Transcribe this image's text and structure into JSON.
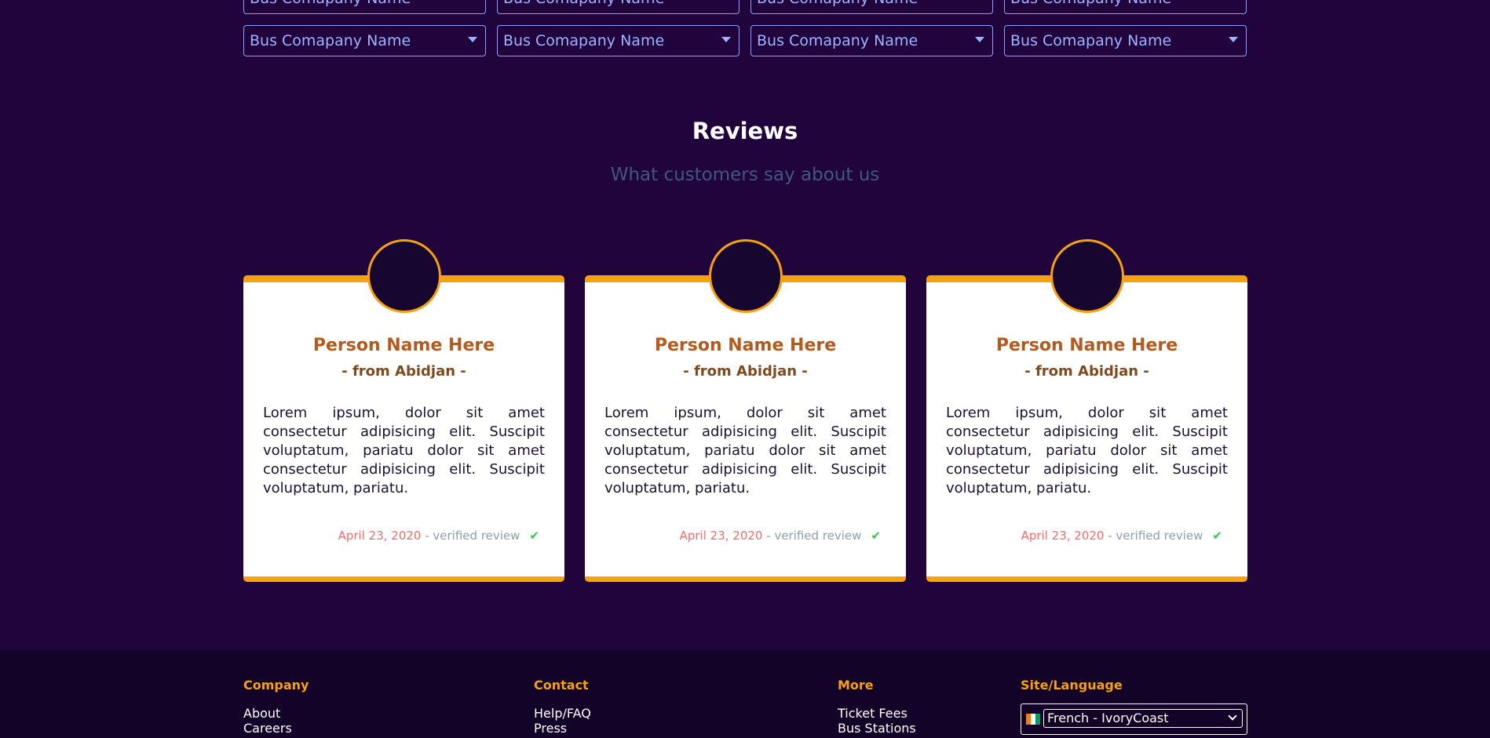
{
  "bus_companies": {
    "row1": [
      "Bus Comapany Name",
      "Bus Comapany Name",
      "Bus Comapany Name",
      "Bus Comapany Name"
    ],
    "row2": [
      "Bus Comapany Name",
      "Bus Comapany Name",
      "Bus Comapany Name",
      "Bus Comapany Name"
    ]
  },
  "reviews": {
    "title": "Reviews",
    "subtitle": "What customers say about us",
    "cards": [
      {
        "name": "Person Name Here",
        "from": "- from Abidjan -",
        "text": "Lorem ipsum, dolor sit amet consectetur adipisicing elit. Suscipit voluptatum, pariatu dolor sit amet consectetur adipisicing elit. Suscipit voluptatum, pariatu.",
        "date": "April 23, 2020",
        "verified": " - verified review"
      },
      {
        "name": "Person Name Here",
        "from": "- from Abidjan -",
        "text": "Lorem ipsum, dolor sit amet consectetur adipisicing elit. Suscipit voluptatum, pariatu dolor sit amet consectetur adipisicing elit. Suscipit voluptatum, pariatu.",
        "date": "April 23, 2020",
        "verified": " - verified review"
      },
      {
        "name": "Person Name Here",
        "from": "- from Abidjan -",
        "text": "Lorem ipsum, dolor sit amet consectetur adipisicing elit. Suscipit voluptatum, pariatu dolor sit amet consectetur adipisicing elit. Suscipit voluptatum, pariatu.",
        "date": "April 23, 2020",
        "verified": " - verified review"
      }
    ]
  },
  "footer": {
    "company": {
      "heading": "Company",
      "links": [
        "About",
        "Careers"
      ]
    },
    "contact": {
      "heading": "Contact",
      "links": [
        "Help/FAQ",
        "Press"
      ]
    },
    "more": {
      "heading": "More",
      "links": [
        "Ticket Fees",
        "Bus Stations"
      ]
    },
    "site_language": {
      "heading": "Site/Language",
      "selected": "French - IvoryCoast"
    }
  },
  "colors": {
    "background": "#22043c",
    "accent": "#f6a20e",
    "footer_bg": "#140328",
    "flag": [
      "#f77f00",
      "#ffffff",
      "#009e60"
    ]
  }
}
